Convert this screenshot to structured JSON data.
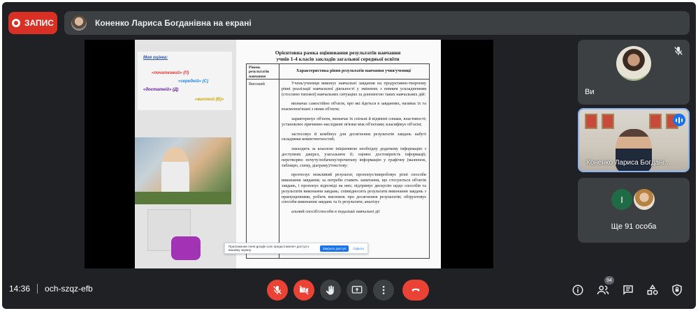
{
  "header": {
    "record_label": "ЗАПИС",
    "presenter_text": "Коненко Лариса Богданівна на екрані"
  },
  "slide": {
    "rating": {
      "title": "Моя оцінка:",
      "initial": "«початковий» (П)",
      "average": "«середній» (С)",
      "sufficient": "«достатній» (Д)",
      "high": "«високий (В)»"
    },
    "doc_title_1": "Орієнтовна рамка оцінювання результатів навчання",
    "doc_title_2": "учнів 1-4 класів закладів загальної середньої освіти",
    "col_level": "Рівень результатів навчання",
    "col_characteristic": "Характеристика рівня результатів навчання учня/учениці",
    "level_name": "Високий",
    "paragraphs": [
      "Учень/учениця виконує навчальні завдання на продуктивно-творчому рівні реалізації навчальної діяльності у змінених з певним ускладненням (стосовно типової) навчальних ситуаціях за допомогою таких навчальних дій:",
      "визначає самостійно об'єкти, про які йдеться в завданнях, називає їх та взаємопов'язані з ними об'єкти;",
      "характеризує об'єкти, визначає їх спільні й відмінні ознаки, властивості; установлює причинно-наслідкові зв'язки між об'єктами; класифікує об'єкти;",
      "застосовує й комбінує для досягнення результатів завдань набуті складники компетентностей;",
      "знаходить за власною ініціативою необхідну додаткову інформацію з доступних джерел, узагальнює її; оцінює достовірність інформації; перетворює почуту/побачену/прочитану інформацію у графічну (малюнок, таблицю, схему, діаграму)/текстову;",
      "прогнозує можливий результат, пропонує/випробовує різні способи виконання завдання; за потреби ставить запитання, що стосуються об'єктів завдань, і пропонує відповіді на них; підтримує дискусію щодо способів та результатів виконання завдань; співвідносить результати виконання завдань з припущеннями, робить висновок про досягнення результатів; обґрунтовує способи виконання завдань та їх результати; аналізує",
      "альний спосіб/способи в подальші навчальні дії"
    ],
    "share_notice_text": "Приложение meet.google.com предоставляет доступ к вашему экрану.",
    "share_notice_stop": "Закрыть доступ",
    "share_notice_hide": "Скрыть"
  },
  "tiles": {
    "self_label": "Ви",
    "speaker_label": "Коненко Лариса Богдані...",
    "more_avatar_letter": "І",
    "more_label": "Ще 91 особа"
  },
  "bottom": {
    "time": "14:36",
    "meeting_code": "och-szqz-efb",
    "participants_count": "94"
  },
  "colors": {
    "app_background": "#202124",
    "tile_background": "#3c4043",
    "danger_red": "#ea4335",
    "record_red": "#d93025",
    "speaking_blue": "#1a73e8"
  },
  "icons": {
    "mic": "mic-off-icon",
    "camera": "camera-off-icon",
    "hand": "raise-hand-icon",
    "present": "present-screen-icon",
    "more": "more-vert-icon",
    "leave": "call-end-icon",
    "info": "info-icon",
    "people": "people-icon",
    "chat": "chat-icon",
    "activities": "activities-icon",
    "host": "host-controls-icon"
  }
}
